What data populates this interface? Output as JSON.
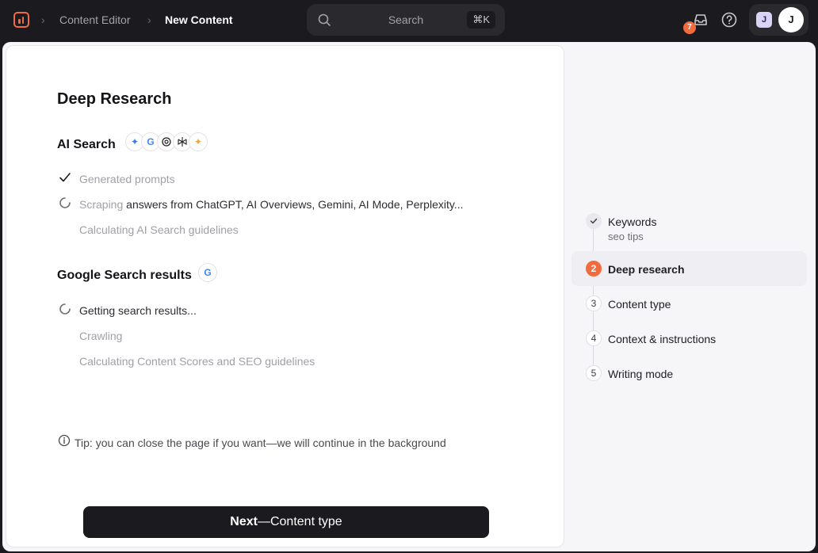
{
  "topbar": {
    "breadcrumb": [
      "Content Editor",
      "New Content"
    ],
    "search": {
      "label": "Search",
      "shortcut": "⌘K"
    },
    "notification_count": "7",
    "avatar_workspace": "J",
    "avatar_user": "J",
    "accent_color": "#f26b3f"
  },
  "card": {
    "title": "Deep Research",
    "ai_section": {
      "title": "AI Search",
      "engine_icons": [
        "gemini-icon",
        "google-icon",
        "chatgpt-icon",
        "perplexity-icon",
        "ai-mode-icon"
      ],
      "steps": [
        {
          "status": "done",
          "text": "Generated prompts"
        },
        {
          "status": "in-progress",
          "text_muted": "Scraping",
          "text_active": " answers from ChatGPT, AI Overviews, Gemini, AI Mode, Perplexity..."
        },
        {
          "status": "pending",
          "text": "Calculating AI Search guidelines"
        }
      ]
    },
    "google_section": {
      "title": "Google Search results",
      "steps": [
        {
          "status": "in-progress",
          "text": "Getting search results..."
        },
        {
          "status": "pending",
          "text": "Crawling"
        },
        {
          "status": "pending",
          "text": "Calculating Content Scores and SEO guidelines"
        }
      ]
    },
    "tip": "Tip: you can close the page if you want—we will continue in the background",
    "next_button": {
      "bold": "Next",
      "rest": "—Content type"
    }
  },
  "stepper": {
    "items": [
      {
        "num": "1",
        "label": "Keywords",
        "sub": "seo tips",
        "state": "done"
      },
      {
        "num": "2",
        "label": "Deep research",
        "state": "current"
      },
      {
        "num": "3",
        "label": "Content type",
        "state": "upcoming"
      },
      {
        "num": "4",
        "label": "Context & instructions",
        "state": "upcoming"
      },
      {
        "num": "5",
        "label": "Writing mode",
        "state": "upcoming"
      }
    ]
  }
}
